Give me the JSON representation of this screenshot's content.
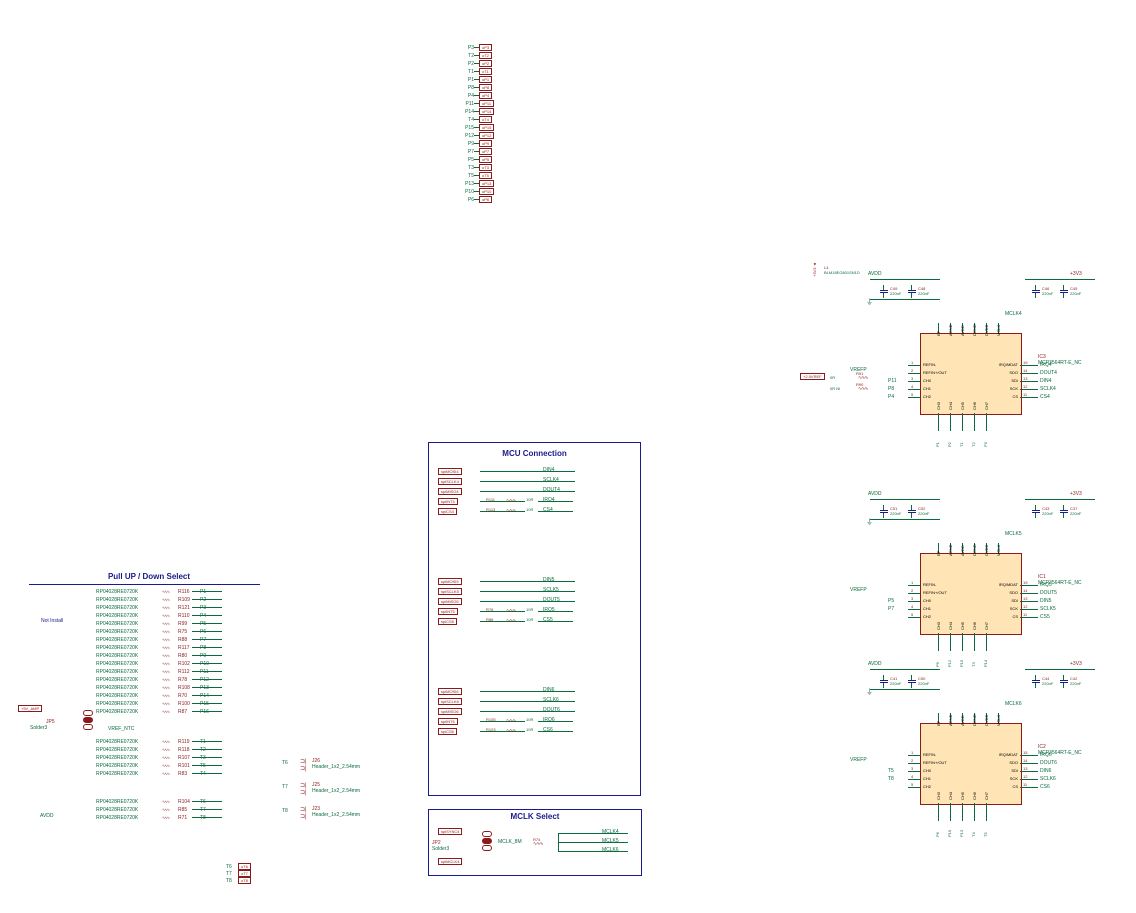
{
  "top_pins": {
    "rows": [
      {
        "pin": "P3",
        "label": "oP3"
      },
      {
        "pin": "T2",
        "label": "oT2"
      },
      {
        "pin": "P2",
        "label": "oP2"
      },
      {
        "pin": "T1",
        "label": "oT1"
      },
      {
        "pin": "P1",
        "label": "oP1"
      },
      {
        "pin": "P8",
        "label": "oP8"
      },
      {
        "pin": "P4",
        "label": "oP4"
      },
      {
        "pin": "P11",
        "label": "oP11"
      },
      {
        "pin": "P14",
        "label": "oP14"
      },
      {
        "pin": "T4",
        "label": "oT4"
      },
      {
        "pin": "P15",
        "label": "oP15"
      },
      {
        "pin": "P12",
        "label": "oP12"
      },
      {
        "pin": "P9",
        "label": "oP9"
      },
      {
        "pin": "P7",
        "label": "oP7"
      },
      {
        "pin": "P5",
        "label": "oP5"
      },
      {
        "pin": "T3",
        "label": "oT3"
      },
      {
        "pin": "T5",
        "label": "oT5"
      },
      {
        "pin": "P13",
        "label": "oP13"
      },
      {
        "pin": "P10",
        "label": "oP10"
      },
      {
        "pin": "P6",
        "label": "oP6"
      }
    ]
  },
  "pull_block": {
    "title": "Pull UP / Down Select",
    "resistors_upper": [
      {
        "ref": "R116",
        "net": "P1",
        "part": "RP04028RE0720K"
      },
      {
        "ref": "R109",
        "net": "P2",
        "part": "RP04028RE0720K"
      },
      {
        "ref": "R121",
        "net": "P3",
        "part": "RP04028RE0720K"
      },
      {
        "ref": "R110",
        "net": "P4",
        "part": "RP04028RE0720K"
      },
      {
        "ref": "R99",
        "net": "P5",
        "part": "RP04028RE0720K"
      },
      {
        "ref": "R75",
        "net": "P6",
        "part": "RP04028RE0720K"
      },
      {
        "ref": "R88",
        "net": "P7",
        "part": "RP04028RE0720K"
      },
      {
        "ref": "R117",
        "net": "P8",
        "part": "RP04028RE0720K"
      },
      {
        "ref": "R80",
        "net": "P9",
        "part": "RP04028RE0720K"
      },
      {
        "ref": "R102",
        "net": "P10",
        "part": "RP04028RE0720K"
      },
      {
        "ref": "R112",
        "net": "P11",
        "part": "RP04028RE0720K"
      },
      {
        "ref": "R78",
        "net": "P12",
        "part": "RP04028RE0720K"
      },
      {
        "ref": "R108",
        "net": "P13",
        "part": "RP04028RE0720K"
      },
      {
        "ref": "R70",
        "net": "P14",
        "part": "RP04028RE0720K"
      },
      {
        "ref": "R100",
        "net": "P15",
        "part": "RP04028RE0720K"
      },
      {
        "ref": "R87",
        "net": "P16",
        "part": "RP04028RE0720K"
      }
    ],
    "resistors_mid": [
      {
        "ref": "R119",
        "net": "T1",
        "part": "RP04028RE0720K"
      },
      {
        "ref": "R118",
        "net": "T2",
        "part": "RP04028RE0720K"
      },
      {
        "ref": "R107",
        "net": "T3",
        "part": "RP04028RE0720K"
      },
      {
        "ref": "R101",
        "net": "T5",
        "part": "RP04028RE0720K"
      },
      {
        "ref": "R83",
        "net": "T4",
        "part": "RP04028RE0720K"
      }
    ],
    "resistors_lower": [
      {
        "ref": "R104",
        "net": "T6",
        "part": "RP04028RE0720K"
      },
      {
        "ref": "R85",
        "net": "T7",
        "part": "RP04028RE0720K"
      },
      {
        "ref": "R71",
        "net": "T8",
        "part": "RP04028RE0720K"
      }
    ],
    "not_install": "Not Install",
    "vref_ntc": "VREF_NTC",
    "avdd": "AVDD",
    "jp5": "JP5",
    "jp5_type": "Solder3",
    "pwr": "+5V_AMP",
    "headers": [
      {
        "ref": "J26",
        "net": "T6",
        "type": "Header_1x2_2.54mm"
      },
      {
        "ref": "J25",
        "net": "T7",
        "type": "Header_1x2_2.54mm"
      },
      {
        "ref": "J23",
        "net": "T8",
        "type": "Header_1x2_2.54mm"
      }
    ],
    "bottom_nets": [
      {
        "pin": "T6",
        "label": "oT6"
      },
      {
        "pin": "T7",
        "label": "oT7"
      },
      {
        "pin": "T8",
        "label": "oT8"
      }
    ]
  },
  "mcu_block": {
    "title": "MCU Connection",
    "groups": [
      {
        "idx": 4,
        "nets": [
          "spiMOSI4",
          "spiSCLK4",
          "spiMISO4",
          "spiINT4",
          "spiCS4"
        ],
        "sigs": [
          "DIN4",
          "SCLK4",
          "DOUT4",
          "IRQ4",
          "CS4"
        ],
        "res": [
          "R111",
          "R113"
        ],
        "val": "10R"
      },
      {
        "idx": 5,
        "nets": [
          "spiMOSI5",
          "spiSCLK5",
          "spiMISO5",
          "spiINT5",
          "spiCS5"
        ],
        "sigs": [
          "DIN5",
          "SCLK5",
          "DOUT5",
          "IRQ5",
          "CS5"
        ],
        "res": [
          "R76",
          "R86"
        ],
        "val": "10R"
      },
      {
        "idx": 6,
        "nets": [
          "spiMOSI6",
          "spiSCLK6",
          "spiMISO6",
          "spiINT6",
          "spiCS6"
        ],
        "sigs": [
          "DIN6",
          "SCLK6",
          "DOUT6",
          "IRQ6",
          "CS6"
        ],
        "res": [
          "R105",
          "R103"
        ],
        "val": "10R"
      }
    ]
  },
  "mclk_block": {
    "title": "MCLK Select",
    "sync": "spiSYNC4",
    "mclk": "spiMCLK4",
    "mclk_net": "MCLK_8M",
    "outs": [
      "MCLK4",
      "MCLK5",
      "MCLK6"
    ],
    "jp2": "JP2",
    "jp2_type": "Solder3",
    "r": "R74"
  },
  "adc": [
    {
      "ic": "IC3",
      "part": "MCP3564RT-E_NC",
      "ferrite": {
        "ref": "L4",
        "part": "BLM18EG601SN1D"
      },
      "caps": [
        {
          "ref": "C49",
          "val": "220nF"
        },
        {
          "ref": "C48",
          "val": "220nF"
        },
        {
          "ref": "C46",
          "val": "220nF"
        },
        {
          "ref": "C45",
          "val": "220nF"
        }
      ],
      "vref": "+2.5VREF",
      "r_in": [
        "R91",
        "R90"
      ],
      "r_vals": [
        "0R",
        "0R NI"
      ],
      "nets": {
        "REFINM": "REFIN-",
        "REFOUT": "REFIN+/OUT",
        "CH0": "CH0",
        "CH1": "CH1",
        "CH2": "CH2"
      },
      "pins_left": [
        "1",
        "2",
        "3",
        "4",
        "5"
      ],
      "in_labels": [
        "P11",
        "P8",
        "P4"
      ],
      "pins_right": [
        "19",
        "14",
        "13",
        "12",
        "11"
      ],
      "sigs_right": [
        "IRQ/MDAT",
        "SDO",
        "SDI",
        "SCK",
        "CS"
      ],
      "out_labels": [
        "IRQ4",
        "DOUT4",
        "DIN4",
        "SCLK4",
        "CS4"
      ],
      "top_pins": [
        "EP",
        "AGND",
        "AVDD",
        "DGND",
        "DVDD",
        "MCLK"
      ],
      "mclk": "MCLK4",
      "bot_pins": [
        "CH3",
        "CH4",
        "CH5",
        "CH6",
        "CH7"
      ],
      "bot_nets": [
        "P1",
        "P2",
        "T1",
        "T2",
        "P3"
      ],
      "pwr": "+3V3",
      "avdd": "AVDD",
      "vrefp": "VREFP"
    },
    {
      "ic": "IC1",
      "part": "MCP3564RT-E_NC",
      "caps": [
        {
          "ref": "C51",
          "val": "220nF"
        },
        {
          "ref": "C52",
          "val": "220nF"
        },
        {
          "ref": "C43",
          "val": "220nF"
        },
        {
          "ref": "C37",
          "val": "220nF"
        }
      ],
      "nets": {
        "REFINM": "REFIN-",
        "REFOUT": "REFIN+/OUT",
        "CH0": "CH0",
        "CH1": "CH1",
        "CH2": "CH2"
      },
      "pins_left": [
        "1",
        "2",
        "3",
        "4",
        "5"
      ],
      "in_labels": [
        "P5",
        "P7"
      ],
      "pins_right": [
        "19",
        "14",
        "13",
        "12",
        "11"
      ],
      "sigs_right": [
        "IRQ/MDAT",
        "SDO",
        "SDI",
        "SCK",
        "CS"
      ],
      "out_labels": [
        "IRQ5",
        "DOUT5",
        "DIN5",
        "SCLK5",
        "CS5"
      ],
      "top_pins": [
        "EP",
        "AGND",
        "AVDD",
        "DGND",
        "DVDD",
        "MCLK"
      ],
      "mclk": "MCLK5",
      "bot_pins": [
        "CH3",
        "CH4",
        "CH5",
        "CH6",
        "CH7"
      ],
      "bot_nets": [
        "P9",
        "P12",
        "P15",
        "T3",
        "P14"
      ],
      "pwr": "+3V3",
      "avdd": "AVDD",
      "vrefp": "VREFP"
    },
    {
      "ic": "IC2",
      "part": "MCP3564RT-E_NC",
      "caps": [
        {
          "ref": "C41",
          "val": "220nF"
        },
        {
          "ref": "C50",
          "val": "220nF"
        },
        {
          "ref": "C44",
          "val": "220nF"
        },
        {
          "ref": "C42",
          "val": "220nF"
        }
      ],
      "nets": {
        "REFINM": "REFIN-",
        "REFOUT": "REFIN+/OUT",
        "CH0": "CH0",
        "CH1": "CH1",
        "CH2": "CH2"
      },
      "pins_left": [
        "1",
        "2",
        "3",
        "4",
        "5"
      ],
      "in_labels": [
        "T5",
        "T8"
      ],
      "pins_right": [
        "15",
        "14",
        "13",
        "12",
        "11"
      ],
      "sigs_right": [
        "IRQ/MDAT",
        "SDO",
        "SDI",
        "SCK",
        "CS"
      ],
      "out_labels": [
        "IRQ6",
        "DOUT6",
        "DIN6",
        "SCLK6",
        "CS6"
      ],
      "top_pins": [
        "EP",
        "AGND",
        "AVDD",
        "DGND",
        "DVDD",
        "MCLK"
      ],
      "mclk": "MCLK6",
      "bot_pins": [
        "CH3",
        "CH4",
        "CH5",
        "CH6",
        "CH7"
      ],
      "bot_nets": [
        "P6",
        "P10",
        "P13",
        "T4",
        "T5"
      ],
      "pwr": "+3V3",
      "avdd": "AVDD",
      "vrefp": "VREFP"
    }
  ]
}
